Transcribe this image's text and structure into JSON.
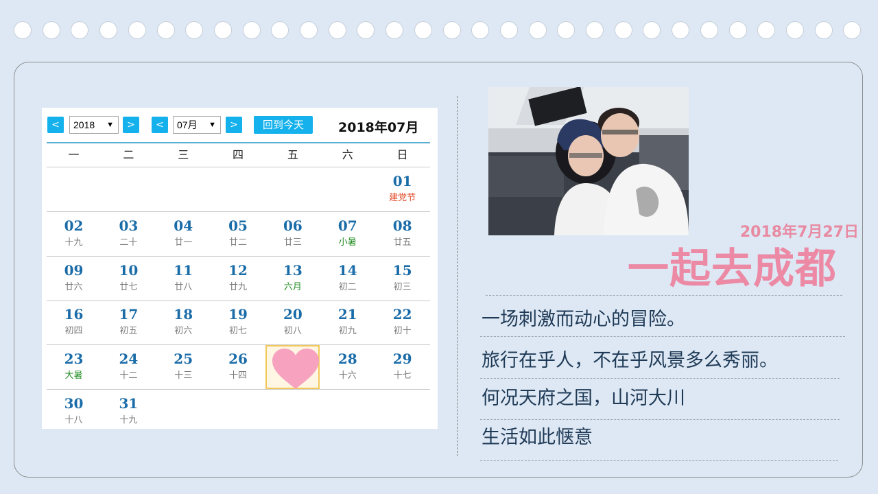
{
  "colors": {
    "background": "#dde8f4",
    "accent_blue": "#14b1ec",
    "pink": "#ec8aa5",
    "text_dark": "#1f3a56"
  },
  "calendar": {
    "prev_label": "<",
    "next_label": ">",
    "year_select": "2018",
    "month_select": "07月",
    "today_button": "回到今天",
    "title": "2018年07月",
    "weekdays": [
      "一",
      "二",
      "三",
      "四",
      "五",
      "六",
      "日"
    ],
    "rows": [
      [
        {
          "day": "",
          "lunar": ""
        },
        {
          "day": "",
          "lunar": ""
        },
        {
          "day": "",
          "lunar": ""
        },
        {
          "day": "",
          "lunar": ""
        },
        {
          "day": "",
          "lunar": ""
        },
        {
          "day": "",
          "lunar": ""
        },
        {
          "day": "01",
          "lunar": "建党节"
        }
      ],
      [
        {
          "day": "02",
          "lunar": "十九"
        },
        {
          "day": "03",
          "lunar": "二十"
        },
        {
          "day": "04",
          "lunar": "廿一"
        },
        {
          "day": "05",
          "lunar": "廿二"
        },
        {
          "day": "06",
          "lunar": "廿三"
        },
        {
          "day": "07",
          "lunar": "小暑"
        },
        {
          "day": "08",
          "lunar": "廿五"
        }
      ],
      [
        {
          "day": "09",
          "lunar": "廿六"
        },
        {
          "day": "10",
          "lunar": "廿七"
        },
        {
          "day": "11",
          "lunar": "廿八"
        },
        {
          "day": "12",
          "lunar": "廿九"
        },
        {
          "day": "13",
          "lunar": "六月"
        },
        {
          "day": "14",
          "lunar": "初二"
        },
        {
          "day": "15",
          "lunar": "初三"
        }
      ],
      [
        {
          "day": "16",
          "lunar": "初四"
        },
        {
          "day": "17",
          "lunar": "初五"
        },
        {
          "day": "18",
          "lunar": "初六"
        },
        {
          "day": "19",
          "lunar": "初七"
        },
        {
          "day": "20",
          "lunar": "初八"
        },
        {
          "day": "21",
          "lunar": "初九"
        },
        {
          "day": "22",
          "lunar": "初十"
        }
      ],
      [
        {
          "day": "23",
          "lunar": "大暑"
        },
        {
          "day": "24",
          "lunar": "十二"
        },
        {
          "day": "25",
          "lunar": "十三"
        },
        {
          "day": "26",
          "lunar": "十四"
        },
        {
          "day": "",
          "lunar": ""
        },
        {
          "day": "28",
          "lunar": "十六"
        },
        {
          "day": "29",
          "lunar": "十七"
        }
      ],
      [
        {
          "day": "30",
          "lunar": "十八"
        },
        {
          "day": "31",
          "lunar": "十九"
        },
        {
          "day": "",
          "lunar": ""
        },
        {
          "day": "",
          "lunar": ""
        },
        {
          "day": "",
          "lunar": ""
        },
        {
          "day": "",
          "lunar": ""
        },
        {
          "day": "",
          "lunar": ""
        }
      ]
    ]
  },
  "right": {
    "date": "2018年7月27日",
    "headline": "一起去成都",
    "lines": [
      "一场刺激而动心的冒险。",
      "旅行在乎人，不在乎风景多么秀丽。",
      "何况天府之国，山河大川",
      "生活如此惬意"
    ]
  }
}
